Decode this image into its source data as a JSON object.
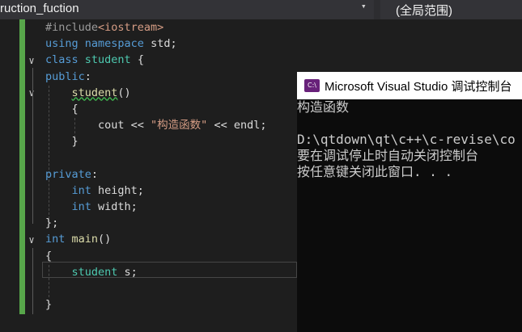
{
  "navbar": {
    "scope_left": "ruction_fuction",
    "dropdown_icon": "▾",
    "scope_right": "(全局范围)"
  },
  "editor": {
    "lines": [
      [
        {
          "t": "#include",
          "c": "pp"
        },
        {
          "t": "<iostream>",
          "c": "ppinc"
        }
      ],
      [
        {
          "t": "using",
          "c": "kw"
        },
        {
          "t": " ",
          "c": "plain"
        },
        {
          "t": "namespace",
          "c": "kw"
        },
        {
          "t": " std;",
          "c": "plain"
        }
      ],
      [
        {
          "t": "class",
          "c": "kw"
        },
        {
          "t": " ",
          "c": "plain"
        },
        {
          "t": "student",
          "c": "cls"
        },
        {
          "t": " {",
          "c": "plain"
        }
      ],
      [
        {
          "t": "public",
          "c": "kw"
        },
        {
          "t": ":",
          "c": "plain"
        }
      ],
      [
        {
          "t": "    ",
          "c": "plain"
        },
        {
          "t": "student",
          "c": "fn squiggle"
        },
        {
          "t": "()",
          "c": "plain"
        }
      ],
      [
        {
          "t": "    {",
          "c": "plain"
        }
      ],
      [
        {
          "t": "        cout << ",
          "c": "plain"
        },
        {
          "t": "\"构造函数\"",
          "c": "str"
        },
        {
          "t": " << endl;",
          "c": "plain"
        }
      ],
      [
        {
          "t": "    }",
          "c": "plain"
        }
      ],
      [
        {
          "t": "",
          "c": "plain"
        }
      ],
      [
        {
          "t": "private",
          "c": "kw"
        },
        {
          "t": ":",
          "c": "plain"
        }
      ],
      [
        {
          "t": "    ",
          "c": "plain"
        },
        {
          "t": "int",
          "c": "kw"
        },
        {
          "t": " height;",
          "c": "plain"
        }
      ],
      [
        {
          "t": "    ",
          "c": "plain"
        },
        {
          "t": "int",
          "c": "kw"
        },
        {
          "t": " width;",
          "c": "plain"
        }
      ],
      [
        {
          "t": "};",
          "c": "plain"
        }
      ],
      [
        {
          "t": "int",
          "c": "kw"
        },
        {
          "t": " ",
          "c": "plain"
        },
        {
          "t": "main",
          "c": "fn"
        },
        {
          "t": "()",
          "c": "plain"
        }
      ],
      [
        {
          "t": "{",
          "c": "plain"
        }
      ],
      [
        {
          "t": "    ",
          "c": "plain"
        },
        {
          "t": "student",
          "c": "cls"
        },
        {
          "t": " s;",
          "c": "plain"
        }
      ],
      [
        {
          "t": "",
          "c": "plain"
        }
      ],
      [
        {
          "t": "}",
          "c": "plain"
        }
      ]
    ],
    "fold_icon": "∨"
  },
  "console": {
    "icon_text": "C:\\",
    "title": "Microsoft Visual Studio 调试控制台",
    "lines": [
      "构造函数",
      "",
      "D:\\qtdown\\qt\\c++\\c-revise\\co",
      "要在调试停止时自动关闭控制台",
      "按任意键关闭此窗口. . ."
    ]
  }
}
